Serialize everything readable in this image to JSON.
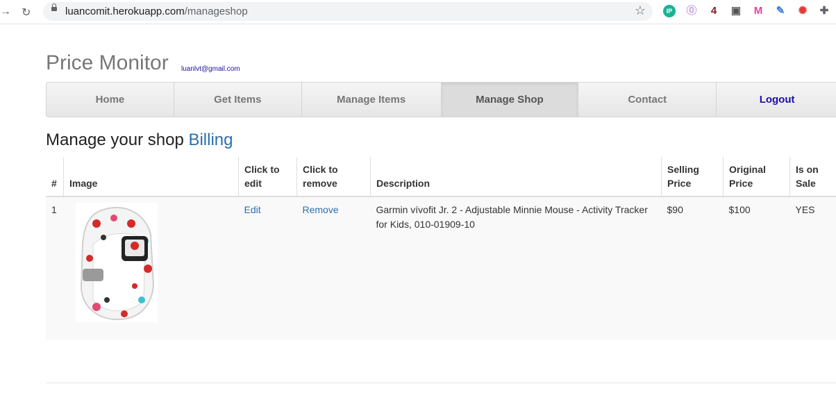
{
  "browser": {
    "url_domain": "luancomit.herokuapp.com",
    "url_path": "/manageshop",
    "extensions": [
      {
        "name": "ip-extension-icon",
        "glyph": "IP",
        "color": "#1ab394"
      },
      {
        "name": "purple-extension-icon",
        "glyph": "⓪",
        "color": "#c9a0dc"
      },
      {
        "name": "four-extension-icon",
        "glyph": "4",
        "color": "#8b1a1a"
      },
      {
        "name": "grid-extension-icon",
        "glyph": "▣",
        "color": "#555555"
      },
      {
        "name": "m-extension-icon",
        "glyph": "M",
        "color": "#e0459b"
      },
      {
        "name": "pen-extension-icon",
        "glyph": "✎",
        "color": "#3b7ddd"
      },
      {
        "name": "color-wheel-extension-icon",
        "glyph": "✺",
        "color": "#e53935"
      },
      {
        "name": "puzzle-extension-icon",
        "glyph": "✚",
        "color": "#5f6368"
      }
    ]
  },
  "site": {
    "brand": "Price Monitor",
    "email": "luanlvt@gmail.com"
  },
  "nav": {
    "items": [
      {
        "label": "Home",
        "name": "nav-home"
      },
      {
        "label": "Get Items",
        "name": "nav-get-items"
      },
      {
        "label": "Manage Items",
        "name": "nav-manage-items"
      },
      {
        "label": "Manage Shop",
        "name": "nav-manage-shop",
        "active": true
      },
      {
        "label": "Contact",
        "name": "nav-contact"
      },
      {
        "label": "Logout",
        "name": "nav-logout"
      }
    ]
  },
  "page": {
    "heading": "Manage your shop",
    "billing_link": "Billing"
  },
  "table": {
    "headers": {
      "num": "#",
      "image": "Image",
      "edit": "Click to edit",
      "remove": "Click to remove",
      "description": "Description",
      "selling": "Selling Price",
      "original": "Original Price",
      "sale": "Is on Sale"
    },
    "rows": [
      {
        "num": "1",
        "image": "garmin-vivofit-minnie-band",
        "edit": "Edit",
        "remove": "Remove",
        "description": "Garmin vívofit Jr. 2 - Adjustable Minnie Mouse - Activity Tracker for Kids, 010-01909-10",
        "selling": "$90",
        "original": "$100",
        "sale": "YES"
      }
    ]
  },
  "colors": {
    "link": "#2a6fb0",
    "brand_text": "#777777"
  }
}
